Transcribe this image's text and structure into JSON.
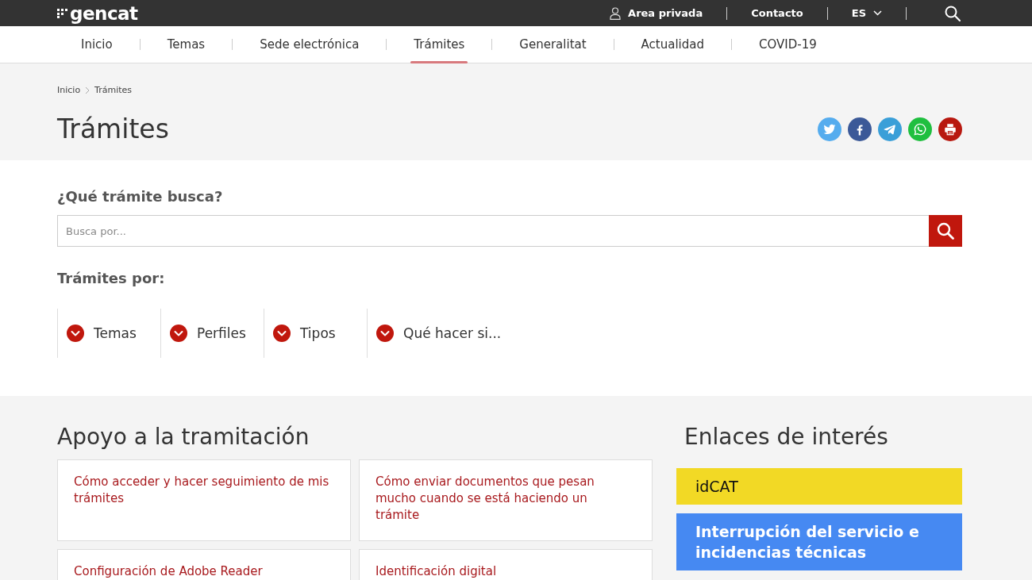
{
  "header": {
    "logo": "gencat",
    "links": [
      {
        "label": "Area privada",
        "kind": "user"
      },
      {
        "label": "Contacto",
        "kind": "link"
      },
      {
        "label": "ES",
        "kind": "language"
      }
    ]
  },
  "nav": {
    "items": [
      {
        "label": "Inicio",
        "selected": false
      },
      {
        "label": "Temas",
        "selected": false
      },
      {
        "label": "Sede electrónica",
        "selected": false
      },
      {
        "label": "Trámites",
        "selected": true
      },
      {
        "label": "Generalitat",
        "selected": false
      },
      {
        "label": "Actualidad",
        "selected": false
      },
      {
        "label": "COVID-19",
        "selected": false
      }
    ]
  },
  "breadcrumb": [
    "Inicio",
    "Trámites"
  ],
  "page_title": "Trámites",
  "share_buttons": [
    {
      "kind": "bird"
    },
    {
      "kind": "f"
    },
    {
      "kind": "plane"
    },
    {
      "kind": "chat"
    },
    {
      "kind": "printer"
    }
  ],
  "search": {
    "label": "¿Qué trámite busca?",
    "placeholder": "Busca por..."
  },
  "filters": {
    "label": "Trámites por:",
    "items": [
      "Temas",
      "Perfiles",
      "Tipos",
      "Qué hacer si..."
    ]
  },
  "support": {
    "title": "Apoyo a la tramitación",
    "cards": [
      "Cómo acceder y hacer seguimiento de mis trámites",
      "Cómo enviar documentos que pesan mucho cuando se está haciendo un trámite",
      "Configuración de Adobe Reader",
      "Identificación digital"
    ]
  },
  "links": {
    "title": "Enlaces de interés",
    "items": [
      {
        "label": "idCAT",
        "color": "#f2d925"
      },
      {
        "label": "Interrupción del servicio e incidencias técnicas",
        "color": "#4689f2"
      }
    ]
  }
}
